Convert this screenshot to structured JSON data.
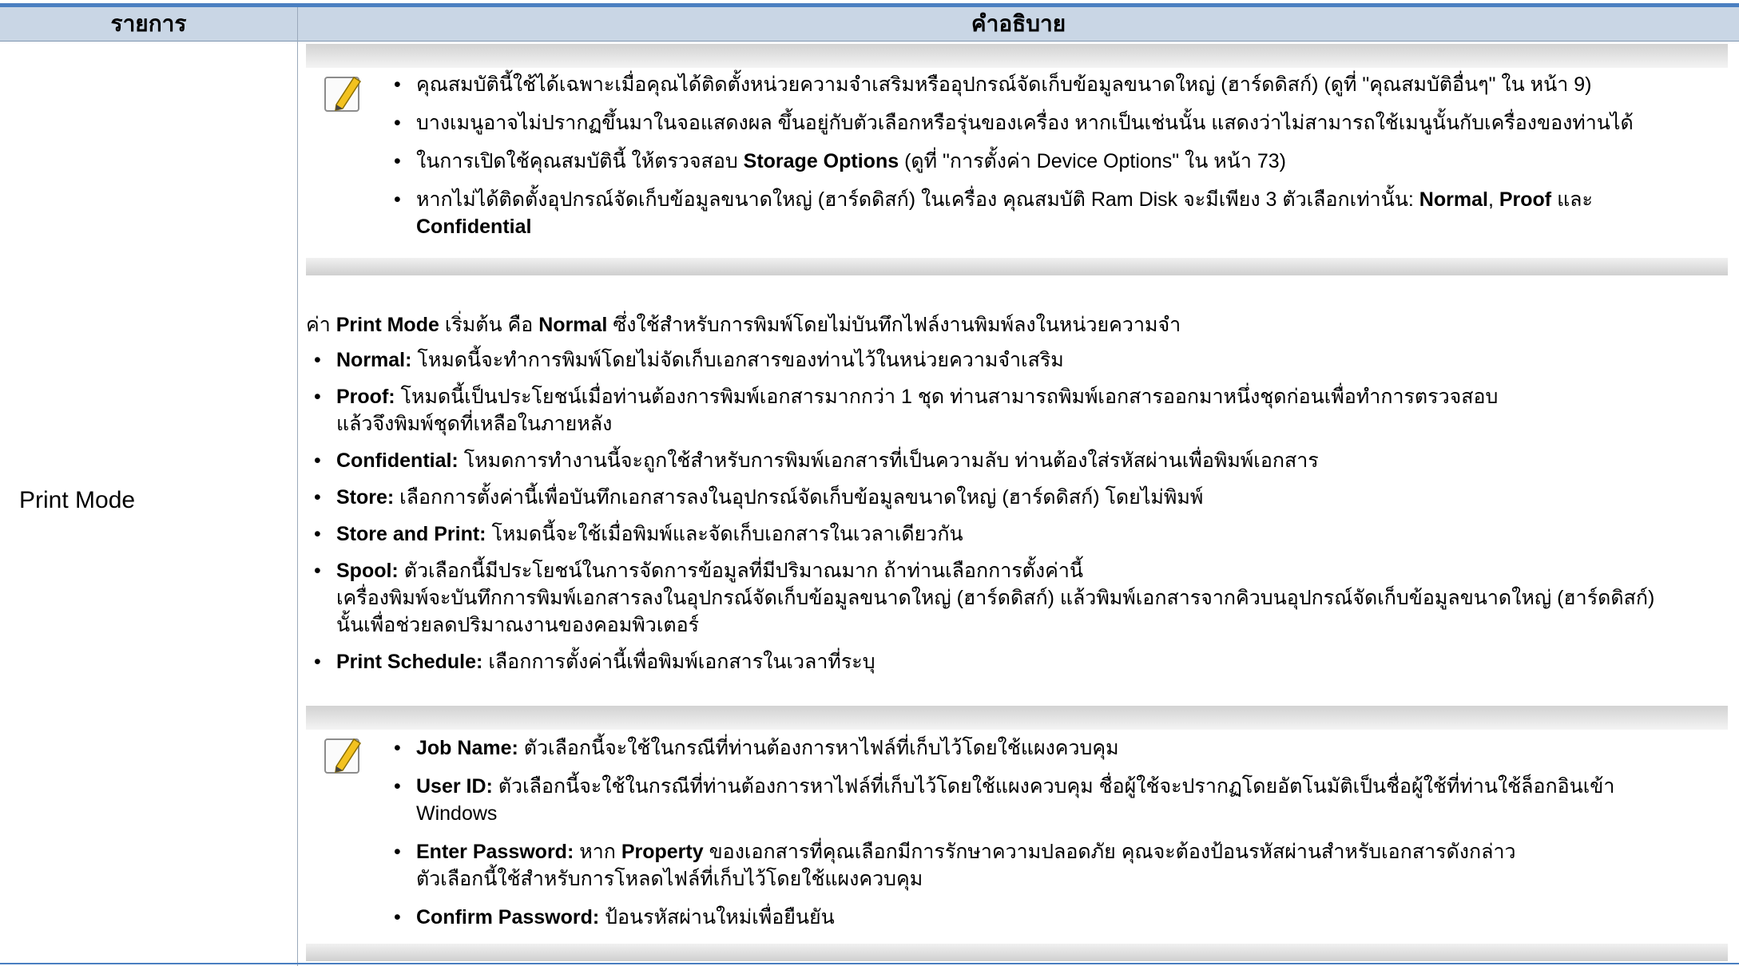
{
  "header": {
    "col_item": "รายการ",
    "col_desc": "คำอธิบาย"
  },
  "row": {
    "label": "Print Mode"
  },
  "icons": {
    "note": "note-pencil-icon"
  },
  "note_top": {
    "items": [
      "คุณสมบัตินี้ใช้ได้เฉพาะเมื่อคุณได้ติดตั้งหน่วยความจำเสริมหรืออุปกรณ์จัดเก็บข้อมูลขนาดใหญ่ (ฮาร์ดดิสก์) (ดูที่ \"คุณสมบัติอื่นๆ\" ใน หน้า 9)",
      "บางเมนูอาจไม่ปรากฏขึ้นมาในจอแสดงผล ขึ้นอยู่กับตัวเลือกหรือรุ่นของเครื่อง หากเป็นเช่นนั้น แสดงว่าไม่สามารถใช้เมนูนั้นกับเครื่องของท่านได้",
      {
        "pre": "ในการเปิดใช้คุณสมบัตินี้ ให้ตรวจสอบ ",
        "bold": "Storage Options",
        "post": " (ดูที่ \"การตั้งค่า Device Options\" ใน หน้า 73)"
      },
      {
        "pre": "หากไม่ได้ติดตั้งอุปกรณ์จัดเก็บข้อมูลขนาดใหญ่ (ฮาร์ดดิสก์) ในเครื่อง คุณสมบัติ Ram Disk จะมีเพียง 3 ตัวเลือกเท่านั้น: ",
        "bold1": "Normal",
        "mid1": ", ",
        "bold2": "Proof",
        "mid2": " และ",
        "bold3": "Confidential"
      }
    ]
  },
  "intro": {
    "pre": "ค่า ",
    "b1": "Print Mode",
    "mid": " เริ่มต้น คือ ",
    "b2": "Normal",
    "post": " ซึ่งใช้สำหรับการพิมพ์โดยไม่บันทึกไฟล์งานพิมพ์ลงในหน่วยความจำ"
  },
  "modes": [
    {
      "name": "Normal:",
      "text": " โหมดนี้จะทำการพิมพ์โดยไม่จัดเก็บเอกสารของท่านไว้ในหน่วยความจำเสริม"
    },
    {
      "name": "Proof:",
      "text": " โหมดนี้เป็นประโยชน์เมื่อท่านต้องการพิมพ์เอกสารมากกว่า 1 ชุด ท่านสามารถพิมพ์เอกสารออกมาหนึ่งชุดก่อนเพื่อทำการตรวจสอบ",
      "line2": "แล้วจึงพิมพ์ชุดที่เหลือในภายหลัง"
    },
    {
      "name": "Confidential:",
      "text": " โหมดการทำงานนี้จะถูกใช้สำหรับการพิมพ์เอกสารที่เป็นความลับ ท่านต้องใส่รหัสผ่านเพื่อพิมพ์เอกสาร"
    },
    {
      "name": "Store:",
      "text": " เลือกการตั้งค่านี้เพื่อบันทึกเอกสารลงในอุปกรณ์จัดเก็บข้อมูลขนาดใหญ่ (ฮาร์ดดิสก์) โดยไม่พิมพ์"
    },
    {
      "name": "Store and Print:",
      "text": " โหมดนี้จะใช้เมื่อพิมพ์และจัดเก็บเอกสารในเวลาเดียวกัน"
    },
    {
      "name": "Spool:",
      "text": " ตัวเลือกนี้มีประโยชน์ในการจัดการข้อมูลที่มีปริมาณมาก ถ้าท่านเลือกการตั้งค่านี้",
      "line2": "เครื่องพิมพ์จะบันทึกการพิมพ์เอกสารลงในอุปกรณ์จัดเก็บข้อมูลขนาดใหญ่ (ฮาร์ดดิสก์) แล้วพิมพ์เอกสารจากคิวบนอุปกรณ์จัดเก็บข้อมูลขนาดใหญ่ (ฮาร์ดดิสก์)",
      "line3": "นั้นเพื่อช่วยลดปริมาณงานของคอมพิวเตอร์"
    },
    {
      "name": "Print Schedule:",
      "text": " เลือกการตั้งค่านี้เพื่อพิมพ์เอกสารในเวลาที่ระบุ"
    }
  ],
  "note_bottom": {
    "items": [
      {
        "name": "Job Name:",
        "text": " ตัวเลือกนี้จะใช้ในกรณีที่ท่านต้องการหาไฟล์ที่เก็บไว้โดยใช้แผงควบคุม"
      },
      {
        "name": "User ID:",
        "text": " ตัวเลือกนี้จะใช้ในกรณีที่ท่านต้องการหาไฟล์ที่เก็บไว้โดยใช้แผงควบคุม ชื่อผู้ใช้จะปรากฏโดยอัตโนมัติเป็นชื่อผู้ใช้ที่ท่านใช้ล็อกอินเข้า",
        "line2": "Windows"
      },
      {
        "name": "Enter Password:",
        "text": " หาก ",
        "bold2": "Property",
        "text2": " ของเอกสารที่คุณเลือกมีการรักษาความปลอดภัย คุณจะต้องป้อนรหัสผ่านสำหรับเอกสารดังกล่าว",
        "line2": "ตัวเลือกนี้ใช้สำหรับการโหลดไฟล์ที่เก็บไว้โดยใช้แผงควบคุม"
      },
      {
        "name": "Confirm Password:",
        "text": " ป้อนรหัสผ่านใหม่เพื่อยืนยัน"
      }
    ]
  }
}
